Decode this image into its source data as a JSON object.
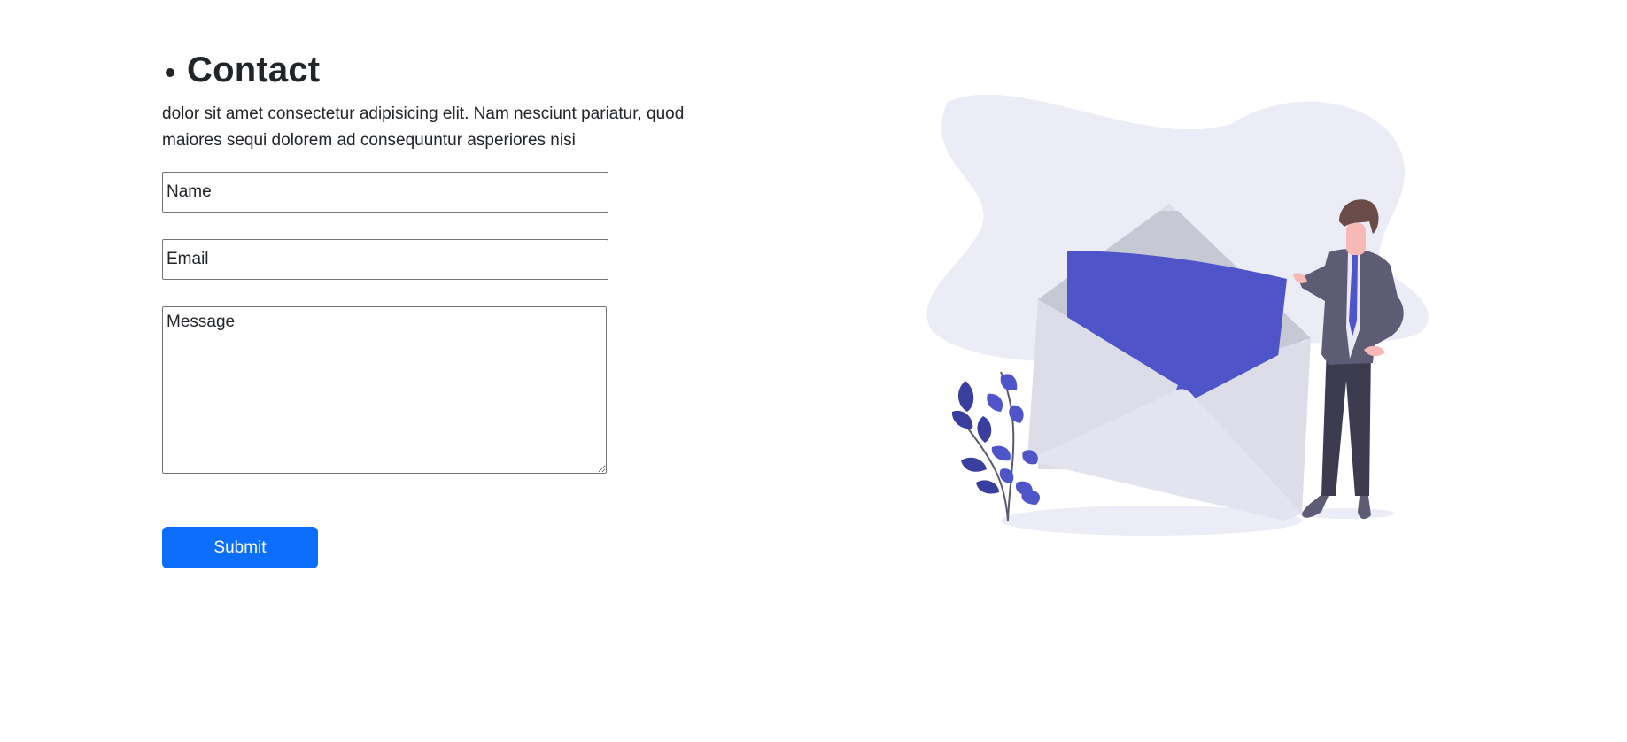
{
  "contact": {
    "title": "Contact",
    "description": "dolor sit amet consectetur adipisicing elit. Nam nesciunt pariatur, quod maiores sequi dolorem ad consequuntur asperiores nisi",
    "name_placeholder": "Name",
    "email_placeholder": "Email",
    "message_placeholder": "Message",
    "submit_label": "Submit"
  },
  "colors": {
    "accent": "#0d6efd",
    "illustration_primary": "#4f55c9",
    "blob": "#ececf7"
  },
  "icons": {
    "bullet": "bullet-dot",
    "illustration": "envelope-man-illustration"
  }
}
